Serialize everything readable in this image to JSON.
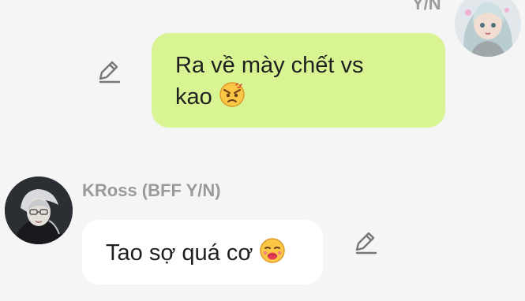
{
  "colors": {
    "background": "#f5f5f5",
    "outgoing_bubble": "#d9f593",
    "incoming_bubble": "#ffffff",
    "sender_name": "#9a9a9a",
    "message_text": "#1f1f1f"
  },
  "messages": [
    {
      "direction": "outgoing",
      "sender": "Y/N",
      "text_line_1": "Ra về mày chết vs",
      "text_line_2": "kao",
      "emoji_icon": "angry-face-icon"
    },
    {
      "direction": "incoming",
      "sender": "KRoss (BFF Y/N)",
      "text": "Tao sợ quá cơ",
      "emoji_icon": "kissing-face-icon"
    }
  ]
}
